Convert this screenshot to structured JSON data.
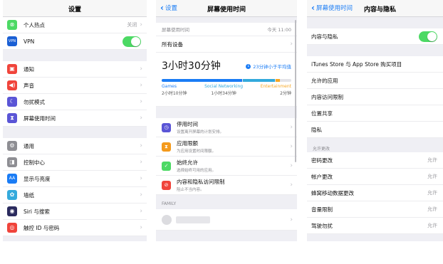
{
  "panel1": {
    "title": "设置",
    "hotspot": {
      "label": "个人热点",
      "value": "关闭"
    },
    "vpn": {
      "label": "VPN",
      "icon_text": "VPN"
    },
    "group2": [
      {
        "label": "通知",
        "icon": "bell-icon",
        "color": "#f0443b",
        "glyph": "▣"
      },
      {
        "label": "声音",
        "icon": "speaker-icon",
        "color": "#f0443b",
        "glyph": "◀)"
      },
      {
        "label": "勿扰模式",
        "icon": "moon-icon",
        "color": "#5a55d6",
        "glyph": "☾"
      },
      {
        "label": "屏幕使用时间",
        "icon": "hourglass-icon",
        "color": "#5a55d6",
        "glyph": "⧗"
      }
    ],
    "group3": [
      {
        "label": "通用",
        "icon": "gear-icon",
        "color": "#8e8e93",
        "glyph": "⚙"
      },
      {
        "label": "控制中心",
        "icon": "switches-icon",
        "color": "#8e8e93",
        "glyph": "◨"
      },
      {
        "label": "显示与亮度",
        "icon": "text-size-icon",
        "color": "#1a7cf5",
        "glyph": "AA"
      },
      {
        "label": "墙纸",
        "icon": "wallpaper-icon",
        "color": "#34aadc",
        "glyph": "✿"
      },
      {
        "label": "Siri 与搜索",
        "icon": "siri-icon",
        "color": "#2b2b5e",
        "glyph": "◉"
      },
      {
        "label": "触控 ID 与密码",
        "icon": "fingerprint-icon",
        "color": "#f0443b",
        "glyph": "◎"
      }
    ]
  },
  "panel2": {
    "back": "设置",
    "title": "屏幕使用时间",
    "caption_left": "屏幕使用时间",
    "caption_right": "今天 11:00",
    "all_devices": "所有设备",
    "total": "3小时30分钟",
    "avg": "23分钟小于平均值",
    "avg_glyph": "↓",
    "categories": [
      {
        "name": "Games",
        "time": "2小时10分钟",
        "color": "#1a7cf5",
        "fraction": 0.62
      },
      {
        "name": "Social Networking",
        "time": "1小时34分钟",
        "color": "#32a9dc",
        "fraction": 0.25
      },
      {
        "name": "Entertainment",
        "time": "2分钟",
        "color": "#f6a623",
        "fraction": 0.03
      }
    ],
    "items": [
      {
        "title": "停用时间",
        "sub": "设置离开屏幕的计划安排。",
        "icon": "downtime-icon",
        "color": "#5a55d6",
        "glyph": "◷"
      },
      {
        "title": "应用限额",
        "sub": "为应用设置时间限额。",
        "icon": "app-limits-icon",
        "color": "#f49a1c",
        "glyph": "⧗"
      },
      {
        "title": "始终允许",
        "sub": "选择始终可用的应用。",
        "icon": "always-allowed-icon",
        "color": "#4cd964",
        "glyph": "✓"
      },
      {
        "title": "内容和隐私访问限制",
        "sub": "阻止不当内容。",
        "icon": "restrictions-icon",
        "color": "#f0443b",
        "glyph": "⊘"
      }
    ],
    "family_header": "FAMILY"
  },
  "panel3": {
    "back": "屏幕使用时间",
    "title": "内容与隐私",
    "toggle_label": "内容与隐私",
    "group1": [
      "iTunes Store 与 App Store 购买项目",
      "允许的应用",
      "内容访问限制",
      "位置共享",
      "隐私"
    ],
    "allow_changes_header": "允许更改",
    "group2": [
      {
        "label": "密码更改",
        "value": "允许"
      },
      {
        "label": "帐户更改",
        "value": "允许"
      },
      {
        "label": "蜂窝移动数据更改",
        "value": "允许"
      },
      {
        "label": "音量限制",
        "value": "允许"
      },
      {
        "label": "驾驶勿扰",
        "value": "允许"
      }
    ]
  }
}
